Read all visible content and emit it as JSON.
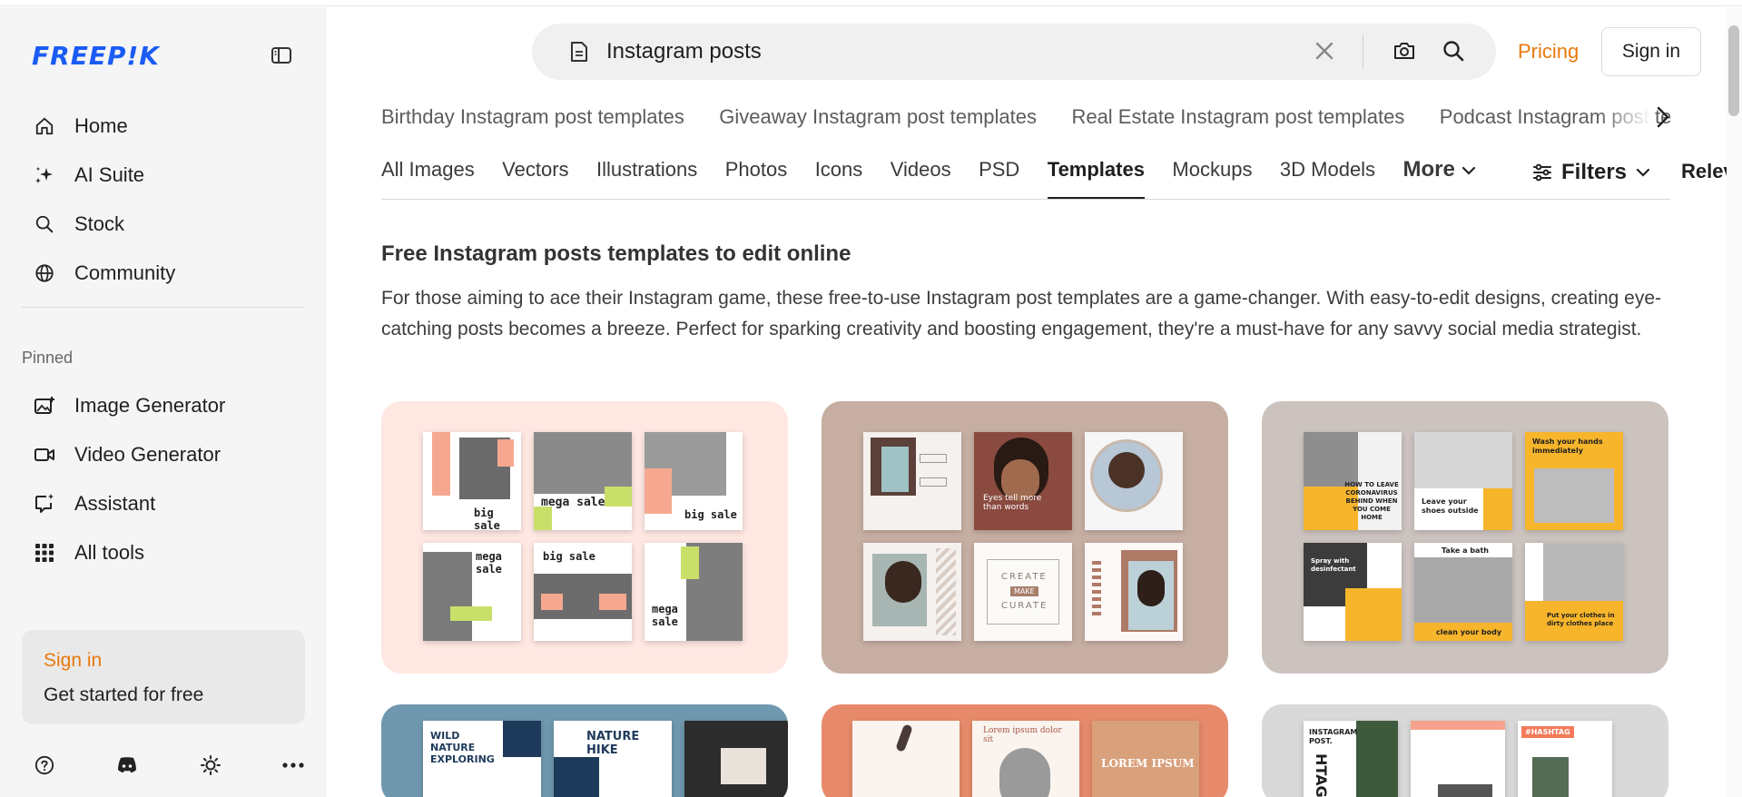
{
  "brand": {
    "logo_text": "FREEP!K",
    "accent": "#1a5cf5",
    "orange": "#e8790c"
  },
  "sidebar": {
    "main_nav": [
      {
        "label": "Home",
        "icon": "home-icon"
      },
      {
        "label": "AI Suite",
        "icon": "sparkles-icon"
      },
      {
        "label": "Stock",
        "icon": "search-icon"
      },
      {
        "label": "Community",
        "icon": "globe-icon"
      }
    ],
    "pinned_label": "Pinned",
    "pinned_nav": [
      {
        "label": "Image Generator",
        "icon": "image-plus-icon"
      },
      {
        "label": "Video Generator",
        "icon": "video-icon"
      },
      {
        "label": "Assistant",
        "icon": "chat-sparkle-icon"
      },
      {
        "label": "All tools",
        "icon": "grid-icon"
      }
    ],
    "signin_card": {
      "title": "Sign in",
      "subtitle": "Get started for free"
    },
    "bottom_icons": [
      "help-icon",
      "discord-icon",
      "sun-icon",
      "more-icon"
    ]
  },
  "header": {
    "search_value": "Instagram posts",
    "pricing_label": "Pricing",
    "signin_label": "Sign in"
  },
  "suggestions": [
    "Birthday Instagram post templates",
    "Giveaway Instagram post templates",
    "Real Estate Instagram post templates",
    "Podcast Instagram post templates"
  ],
  "tabs": {
    "items": [
      "All Images",
      "Vectors",
      "Illustrations",
      "Photos",
      "Icons",
      "Videos",
      "PSD",
      "Templates",
      "Mockups",
      "3D Models"
    ],
    "active": "Templates",
    "more_label": "More",
    "filters_label": "Filters",
    "sort_label": "Relevance"
  },
  "content": {
    "title": "Free Instagram posts templates to edit online",
    "description": "For those aiming to ace their Instagram game, these free-to-use Instagram post templates are a game-changer. With easy-to-edit designs, creating eye-catching posts becomes a breeze. Perfect for sparking creativity and boosting engagement, they're a must-have for any savvy social media strategist."
  },
  "cards": {
    "c1": {
      "texts": [
        "big sale",
        "mega sale",
        "big sale",
        "mega sale",
        "big sale",
        "mega sale"
      ]
    },
    "c2": {
      "texts": [
        "Eyes tell more than words",
        "CREATE",
        "MAKE",
        "CURATE"
      ]
    },
    "c3": {
      "texts": [
        "HOW TO LEAVE CORONAVIRUS BEHIND WHEN YOU COME HOME",
        "Leave your shoes outside",
        "Wash your hands immediately",
        "Spray with desinfectant",
        "Take a bath",
        "clean your body",
        "Put your clothes in dirty clothes place"
      ]
    },
    "c4": {
      "texts": [
        "WILD NATURE EXPLORING",
        "NATURE HIKE"
      ]
    },
    "c5": {
      "texts": [
        "Lorem ipsum dolor sit",
        "LOREM IPSUM"
      ]
    },
    "c6": {
      "texts": [
        "INSTAGRAM POST.",
        "#HASHTAG",
        "HTAG"
      ]
    }
  }
}
